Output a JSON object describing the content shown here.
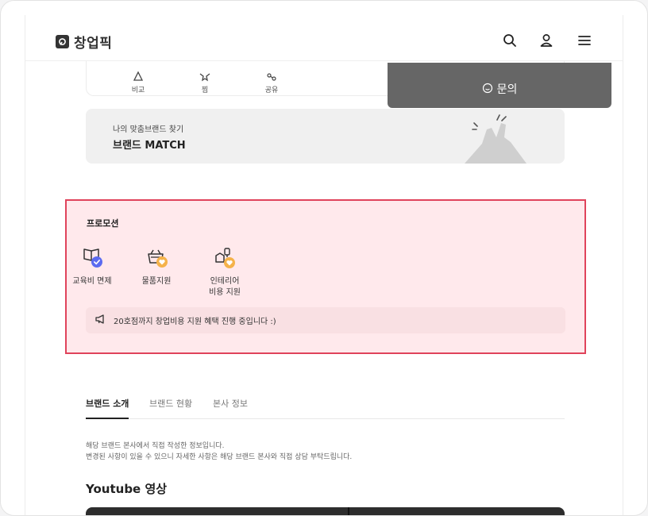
{
  "header": {
    "brand": "창업픽",
    "icons": [
      "search-icon",
      "user-icon",
      "menu-icon"
    ]
  },
  "actions": {
    "items": [
      {
        "label": "비교",
        "icon": "compare-icon"
      },
      {
        "label": "찜",
        "icon": "star-icon"
      },
      {
        "label": "공유",
        "icon": "share-icon"
      }
    ],
    "inquiry_label": "문의"
  },
  "match_banner": {
    "subtitle": "나의 맞춤브랜드 찾기",
    "title": "브랜드 MATCH"
  },
  "promotion": {
    "title": "프로모션",
    "items": [
      {
        "line1": "교육비 면제",
        "line2": "",
        "icon": "book-check-icon",
        "badge_color": "#5b6bf0"
      },
      {
        "line1": "물품지원",
        "line2": "",
        "icon": "basket-heart-icon",
        "badge_color": "#f5b24a"
      },
      {
        "line1": "인테리어",
        "line2": "비용 지원",
        "icon": "interior-heart-icon",
        "badge_color": "#f5b24a"
      }
    ],
    "notice": "20호점까지 창업비용 지원 혜택 진행 중입니다 :)",
    "highlight_color": "#e0435b"
  },
  "tabs": {
    "items": [
      "브랜드 소개",
      "브랜드 현황",
      "본사 정보"
    ],
    "active_index": 0
  },
  "info": {
    "line1": "해당 브랜드 본사에서 직접 작성한 정보입니다.",
    "line2": "변경된 사항이 있을 수 있으니 자세한 사항은 해당 브랜드 본사와 직접 상담 부탁드립니다."
  },
  "youtube": {
    "title": "Youtube 영상"
  }
}
